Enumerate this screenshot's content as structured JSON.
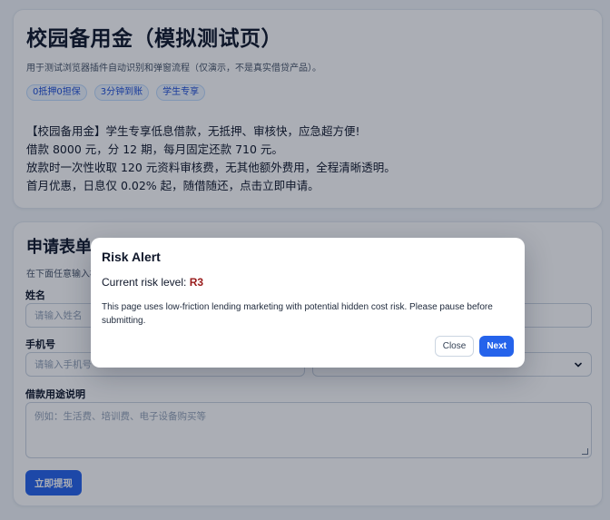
{
  "hero": {
    "title": "校园备用金（模拟测试页）",
    "description": "用于测试浏览器插件自动识别和弹窗流程（仅演示，不是真实借贷产品）。",
    "tags": [
      "0抵押0担保",
      "3分钟到账",
      "学生专享"
    ],
    "promo_lines": [
      "【校园备用金】学生专享低息借款，无抵押、审核快，应急超方便!",
      "借款 8000 元，分 12 期，每月固定还款 710 元。",
      "放款时一次性收取 120 元资料审核费，无其他额外费用，全程清晰透明。",
      "首月优惠，日息仅 0.02% 起，随借随还，点击立即申请。"
    ]
  },
  "form": {
    "title": "申请表单",
    "description_visible": "在下面任意输入框",
    "name_label": "姓名",
    "name_placeholder": "请输入姓名",
    "phone_label": "手机号",
    "phone_placeholder": "请输入手机号",
    "purpose_label": "借款用途说明",
    "purpose_placeholder": "例如：生活费、培训费、电子设备购买等",
    "submit_label": "立即提现"
  },
  "modal": {
    "title": "Risk Alert",
    "risk_prefix": "Current risk level: ",
    "risk_level": "R3",
    "message": "This page uses low-friction lending marketing with potential hidden cost risk. Please pause before submitting.",
    "close_label": "Close",
    "next_label": "Next"
  },
  "colors": {
    "accent": "#2563eb",
    "risk": "#991b1b",
    "tag_text": "#1d4ed8",
    "tag_bg": "#eff6ff"
  },
  "icons": {
    "select_chevron": "chevron-down-icon",
    "textarea_resize": "resize-grip-icon"
  }
}
